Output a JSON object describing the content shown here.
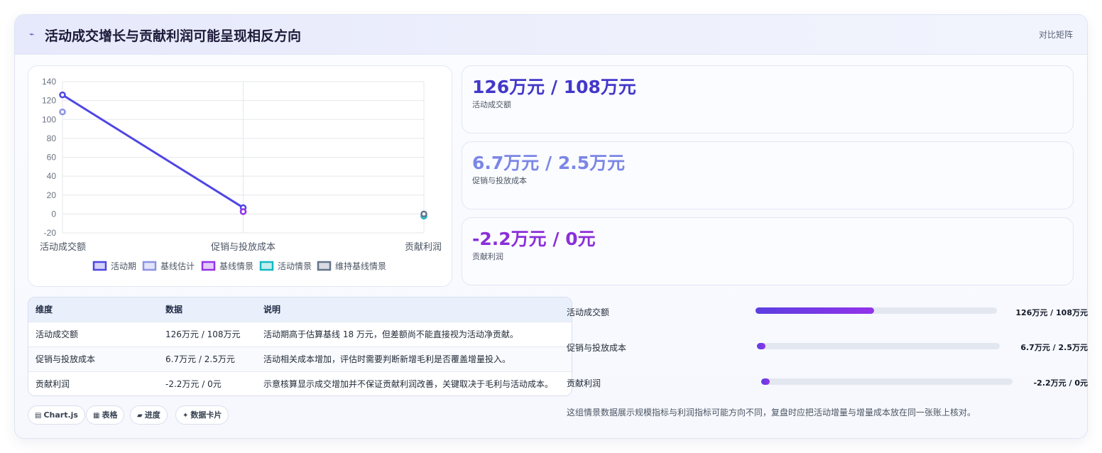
{
  "header": {
    "icon": "trend-icon",
    "title": "活动成交增长与贡献利润可能呈现相反方向",
    "tag": "对比矩阵"
  },
  "chart_data": {
    "type": "line",
    "categories": [
      "活动成交额",
      "促销与投放成本",
      "贡献利润"
    ],
    "ylim": [
      -20,
      140
    ],
    "yticks": [
      -20,
      0,
      20,
      40,
      60,
      80,
      100,
      120,
      140
    ],
    "grid": true,
    "legend_position": "bottom",
    "series": [
      {
        "name": "活动期",
        "values": [
          126,
          6.7,
          null
        ],
        "color": "#4f46e5",
        "line": true
      },
      {
        "name": "基线估计",
        "values": [
          108,
          2.5,
          null
        ],
        "color": "#8b93e6",
        "line": false
      },
      {
        "name": "基线情景",
        "values": [
          null,
          2.5,
          -2.2
        ],
        "color": "#9333ea",
        "line": false
      },
      {
        "name": "活动情景",
        "values": [
          null,
          null,
          -2.2
        ],
        "color": "#14b8c4",
        "line": false
      },
      {
        "name": "维持基线情景",
        "values": [
          null,
          null,
          0
        ],
        "color": "#64748b",
        "line": false
      }
    ]
  },
  "stats": [
    {
      "value": "126万元 / 108万元",
      "label": "活动成交额",
      "color": "#4338ca"
    },
    {
      "value": "6.7万元 / 2.5万元",
      "label": "促销与投放成本",
      "color": "#7b86e6"
    },
    {
      "value": "-2.2万元 / 0元",
      "label": "贡献利润",
      "color": "#8b2fd9"
    }
  ],
  "table": {
    "headers": [
      "维度",
      "数据",
      "说明"
    ],
    "rows": [
      [
        "活动成交额",
        "126万元 / 108万元",
        "活动期高于估算基线 18 万元，但差额尚不能直接视为活动净贡献。"
      ],
      [
        "促销与投放成本",
        "6.7万元 / 2.5万元",
        "活动相关成本增加，评估时需要判断新增毛利是否覆盖增量投入。"
      ],
      [
        "贡献利润",
        "-2.2万元 / 0元",
        "示意核算显示成交增加并不保证贡献利润改善，关键取决于毛利与活动成本。"
      ]
    ]
  },
  "chips": [
    {
      "icon": "▤",
      "label": "Chart.js"
    },
    {
      "icon": "▦",
      "label": "表格"
    },
    {
      "icon": "▰",
      "label": "进度"
    },
    {
      "icon": "✦",
      "label": "数据卡片"
    }
  ],
  "progress": [
    {
      "label": "活动成交额",
      "value": "126万元 / 108万元",
      "fraction": 0.49
    },
    {
      "label": "促销与投放成本",
      "value": "6.7万元 / 2.5万元",
      "fraction": 0.03
    },
    {
      "label": "贡献利润",
      "value": "-2.2万元 / 0元",
      "fraction": 0.03
    }
  ],
  "note": "这组情景数据展示规模指标与利润指标可能方向不同，复盘时应把活动增量与增量成本放在同一张账上核对。"
}
